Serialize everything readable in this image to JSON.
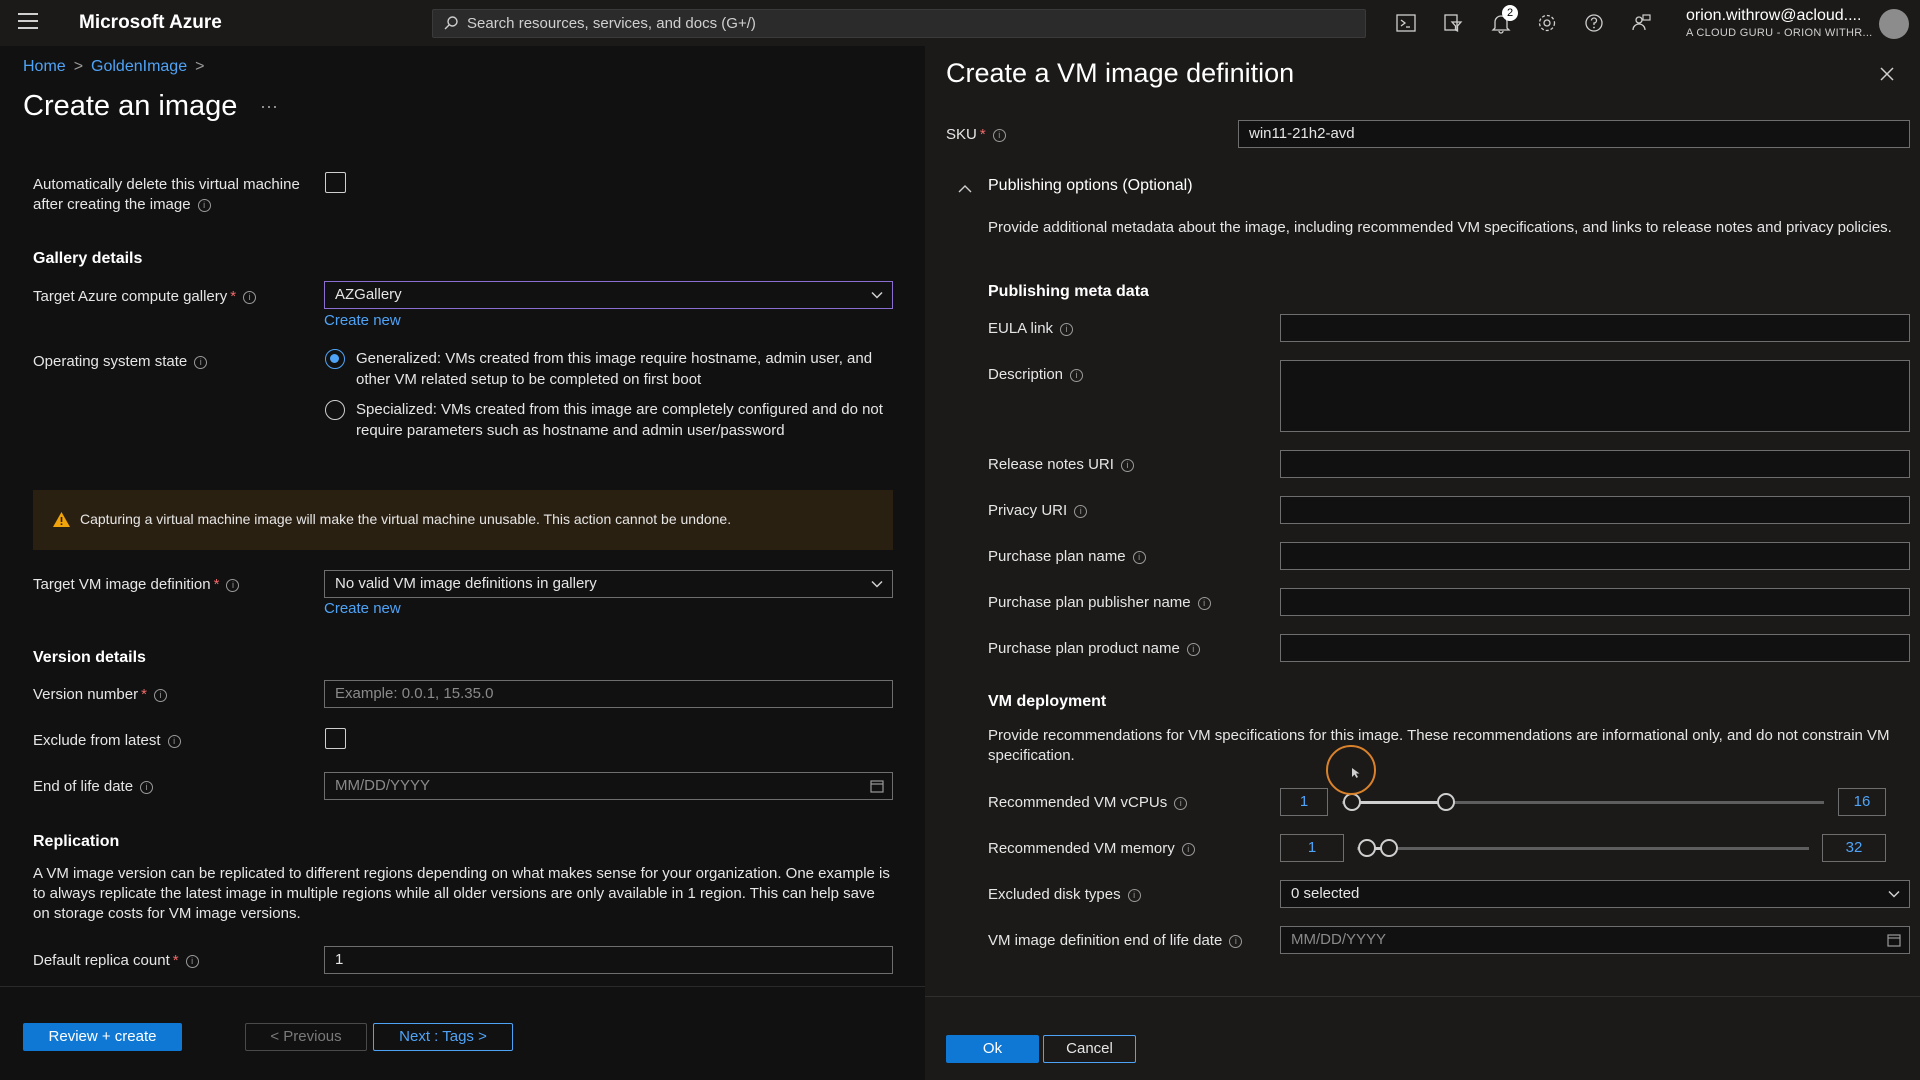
{
  "topbar": {
    "brand": "Microsoft Azure",
    "search_placeholder": "Search resources, services, and docs (G+/)",
    "notification_count": "2",
    "account_email": "orion.withrow@acloud....",
    "account_tenant": "A CLOUD GURU - ORION WITHR..."
  },
  "breadcrumb": [
    "Home",
    "GoldenImage"
  ],
  "page": {
    "title": "Create an image",
    "more": "···"
  },
  "form": {
    "auto_delete_label_1": "Automatically delete this virtual machine",
    "auto_delete_label_2": "after creating the image",
    "gallery_section": "Gallery details",
    "target_gallery_label": "Target Azure compute gallery",
    "target_gallery_value": "AZGallery",
    "create_new_1": "Create new",
    "os_state_label": "Operating system state",
    "generalized_text": "Generalized: VMs created from this image require hostname, admin user, and other VM related setup to be completed on first boot",
    "specialized_text": "Specialized: VMs created from this image are completely configured and do not require parameters such as hostname and admin user/password",
    "warning_text": "Capturing a virtual machine image will make the virtual machine unusable. This action cannot be undone.",
    "target_def_label": "Target VM image definition",
    "target_def_value": "No valid VM image definitions in gallery",
    "create_new_2": "Create new",
    "version_section": "Version details",
    "version_number_label": "Version number",
    "version_number_placeholder": "Example: 0.0.1, 15.35.0",
    "exclude_latest_label": "Exclude from latest",
    "eol_label": "End of life date",
    "eol_placeholder": "MM/DD/YYYY",
    "replication_section": "Replication",
    "replication_text": "A VM image version can be replicated to different regions depending on what makes sense for your organization. One example is to always replicate the latest image in multiple regions while all older versions are only available in 1 region. This can help save on storage costs for VM image versions.",
    "replica_count_label": "Default replica count",
    "replica_count_value": "1"
  },
  "footer": {
    "review_create": "Review + create",
    "previous": "< Previous",
    "next": "Next : Tags >"
  },
  "panel": {
    "title": "Create a VM image definition",
    "sku_label": "SKU",
    "sku_value": "win11-21h2-avd",
    "publishing_options": "Publishing options (Optional)",
    "publishing_desc": "Provide additional metadata about the image, including recommended VM specifications, and links to release notes and privacy policies.",
    "meta_section": "Publishing meta data",
    "eula_label": "EULA link",
    "description_label": "Description",
    "release_notes_label": "Release notes URI",
    "privacy_label": "Privacy URI",
    "plan_name_label": "Purchase plan name",
    "plan_publisher_label": "Purchase plan publisher name",
    "plan_product_label": "Purchase plan product name",
    "deploy_section": "VM deployment",
    "deploy_desc": "Provide recommendations for VM specifications for this image. These recommendations are informational only, and do not constrain VM specification.",
    "vcpu_label": "Recommended VM vCPUs",
    "vcpu_min": "1",
    "vcpu_max": "16",
    "vcpu_range_fraction": [
      0.0,
      0.2
    ],
    "memory_label": "Recommended VM memory",
    "memory_min": "1",
    "memory_max": "32",
    "memory_range_fraction": [
      0.0,
      0.05
    ],
    "disk_label": "Excluded disk types",
    "disk_value": "0 selected",
    "def_eol_label": "VM image definition end of life date",
    "def_eol_placeholder": "MM/DD/YYYY",
    "ok": "Ok",
    "cancel": "Cancel"
  },
  "colors": {
    "accent": "#4fa3f7",
    "primary_button": "#0f78d4",
    "warning_bg": "#2a2012",
    "required": "#f16b6b"
  }
}
